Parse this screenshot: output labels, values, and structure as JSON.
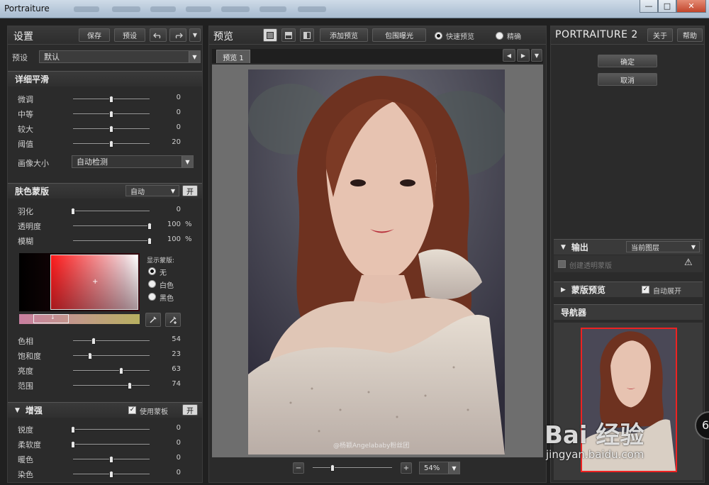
{
  "window": {
    "title": "Portraiture",
    "controls": [
      "—",
      "□",
      "✕"
    ]
  },
  "left": {
    "header": {
      "title": "设置",
      "save": "保存",
      "preset_btn": "预设",
      "undo_icon": "undo-icon",
      "redo_icon": "redo-icon"
    },
    "preset": {
      "label": "预设",
      "value": "默认"
    },
    "detail": {
      "title": "详细平滑",
      "rows": [
        {
          "label": "微调",
          "value": "0",
          "pos": 0.5
        },
        {
          "label": "中等",
          "value": "0",
          "pos": 0.5
        },
        {
          "label": "较大",
          "value": "0",
          "pos": 0.5
        },
        {
          "label": "阈值",
          "value": "20",
          "pos": 0.5
        }
      ],
      "size_label": "画像大小",
      "size_value": "自动检测"
    },
    "skin": {
      "title": "肤色蒙版",
      "mode": "自动",
      "toggle": "开",
      "rows": [
        {
          "label": "羽化",
          "value": "0",
          "unit": "",
          "pos": 0.0
        },
        {
          "label": "透明度",
          "value": "100",
          "unit": "%",
          "pos": 1.0
        },
        {
          "label": "模糊",
          "value": "100",
          "unit": "%",
          "pos": 1.0
        }
      ],
      "mask_title": "显示蒙版:",
      "mask_options": [
        "无",
        "白色",
        "黑色"
      ],
      "mask_selected": 0,
      "color_rows": [
        {
          "label": "色相",
          "value": "54",
          "pos": 0.27
        },
        {
          "label": "饱和度",
          "value": "23",
          "pos": 0.22
        },
        {
          "label": "亮度",
          "value": "63",
          "pos": 0.63
        },
        {
          "label": "范围",
          "value": "74",
          "pos": 0.74
        }
      ],
      "colors": {
        "picker_top": "#ff0000",
        "strip_left": "#c87fa0",
        "strip_right": "#b8b060"
      }
    },
    "enhance": {
      "title": "增强",
      "use_mask": "使用蒙板",
      "toggle": "开",
      "rows": [
        {
          "label": "锐度",
          "value": "0",
          "pos": 0.0
        },
        {
          "label": "柔软度",
          "value": "0",
          "pos": 0.0
        },
        {
          "label": "暖色",
          "value": "0",
          "pos": 0.5
        },
        {
          "label": "染色",
          "value": "0",
          "pos": 0.5
        }
      ]
    }
  },
  "center": {
    "title": "预览",
    "add_preview": "添加预览",
    "clip_exposure": "包围曝光",
    "fast_preview": "快速预览",
    "precise": "精确",
    "tab": "预览 1",
    "watermark": "@杨颖Angelababy粉丝团",
    "zoom_value": "54%",
    "zoom_pos": 0.25,
    "colors": {
      "photo_bg": "#3c3a48",
      "hair": "#7a3a24",
      "skin": "#e8c2b0",
      "dress": "#d9cfc4"
    }
  },
  "right": {
    "brand": "PORTRAITURE",
    "version": "2",
    "about": "关于",
    "help": "帮助",
    "ok": "确定",
    "cancel": "取消",
    "output": {
      "title": "输出",
      "value": "当前图层",
      "create_mask": "创建透明蒙版"
    },
    "mask_preview": {
      "title": "蒙版预览",
      "auto_expand": "自动展开"
    },
    "navigator": {
      "title": "导航器"
    }
  },
  "overlay": {
    "logo": "Bai 经验",
    "url": "jingyan.baidu.com",
    "badge": "6"
  }
}
